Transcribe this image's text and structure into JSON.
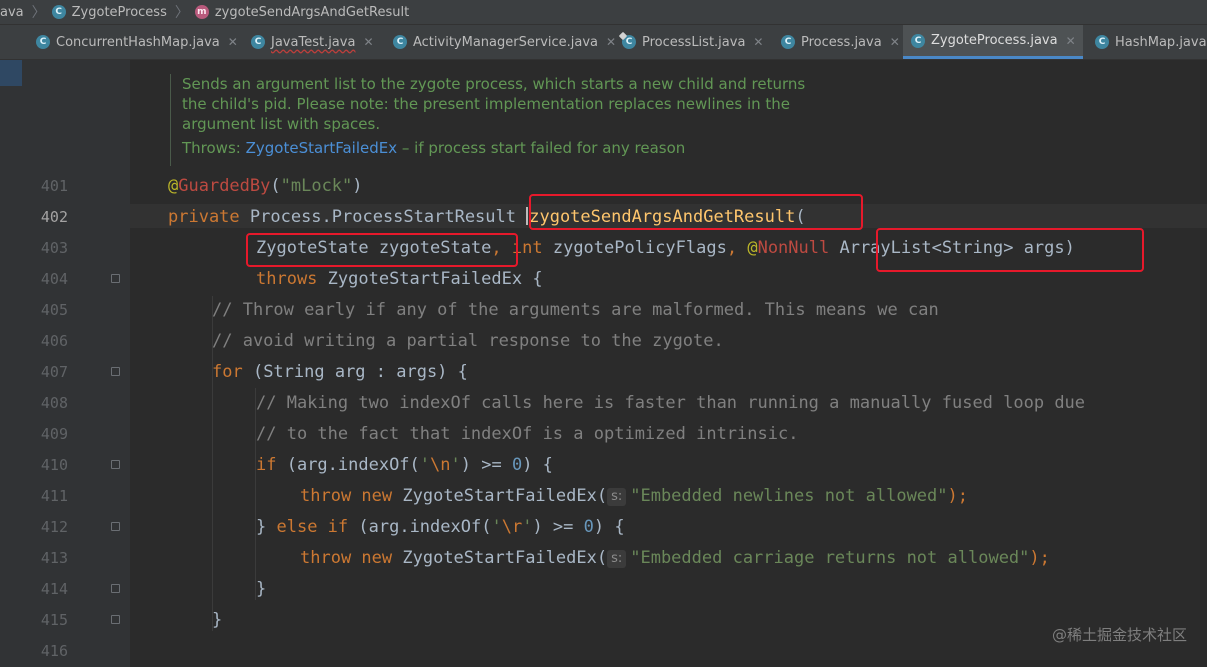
{
  "breadcrumb": {
    "items": [
      {
        "label": "ava",
        "icon": null
      },
      {
        "label": "ZygoteProcess",
        "icon": "class-icon"
      },
      {
        "label": "zygoteSendArgsAndGetResult",
        "icon": "method-icon"
      }
    ]
  },
  "tabs": [
    {
      "label": "ConcurrentHashMap.java",
      "icon": "class-icon",
      "active": false
    },
    {
      "label": "JavaTest.java",
      "icon": "class-icon",
      "active": false,
      "error": true
    },
    {
      "label": "ActivityManagerService.java",
      "icon": "class-icon",
      "active": false
    },
    {
      "label": "ProcessList.java",
      "icon": "class-icon",
      "active": false
    },
    {
      "label": "Process.java",
      "icon": "class-icon",
      "active": false
    },
    {
      "label": "ZygoteProcess.java",
      "icon": "class-icon",
      "active": true
    },
    {
      "label": "HashMap.java",
      "icon": "class-icon",
      "active": false
    }
  ],
  "doc_comment": {
    "lines": [
      "Sends an argument list to the zygote process, which starts a new child and returns",
      "the child's pid. Please note: the present implementation replaces newlines in the",
      "argument list with spaces."
    ],
    "throws_label": "Throws:",
    "throws_link": "ZygoteStartFailedEx",
    "throws_text": " – if process start failed for any reason"
  },
  "line_numbers": [
    "401",
    "402",
    "403",
    "404",
    "405",
    "406",
    "407",
    "408",
    "409",
    "410",
    "411",
    "412",
    "413",
    "414",
    "415",
    "416"
  ],
  "current_line": "402",
  "code": {
    "l401": {
      "at": "@",
      "annotation": "GuardedBy",
      "open": "(",
      "str": "\"mLock\"",
      "close": ")"
    },
    "l402": {
      "kw": "private",
      "type": " Process.ProcessStartResult ",
      "method": "zygoteSendArgsAndGetResult",
      "paren": "("
    },
    "l403": {
      "p1": "ZygoteState zygoteState",
      "comma1": ",",
      "kw_int": " int",
      "p2": " zygotePolicyFlags",
      "comma2": ",",
      "at": " @",
      "annotation": "NonNull",
      "p3": " ArrayList<String> args",
      "close": ")"
    },
    "l404": {
      "kw": "throws",
      "rest": " ZygoteStartFailedEx {"
    },
    "l405": "// Throw early if any of the arguments are malformed. This means we can",
    "l406": "// avoid writing a partial response to the zygote.",
    "l407": {
      "kw": "for",
      "rest": " (String arg : args) {"
    },
    "l408": "// Making two indexOf calls here is faster than running a manually fused loop due",
    "l409": "// to the fact that indexOf is a optimized intrinsic.",
    "l410": {
      "kw": "if",
      "a": " (arg.indexOf(",
      "q1": "'",
      "esc": "\\n",
      "q2": "'",
      "b": ") >= ",
      "num": "0",
      "c": ") {"
    },
    "l411": {
      "kw1": "throw",
      "kw2": " new",
      "type": " ZygoteStartFailedEx(",
      "hint": "s:",
      "str": "\"Embedded newlines not allowed\"",
      "end": ");"
    },
    "l412": {
      "brace": "} ",
      "kw1": "else",
      "kw2": " if",
      "a": " (arg.indexOf(",
      "q1": "'",
      "esc": "\\r",
      "q2": "'",
      "b": ") >= ",
      "num": "0",
      "c": ") {"
    },
    "l413": {
      "kw1": "throw",
      "kw2": " new",
      "type": " ZygoteStartFailedEx(",
      "hint": "s:",
      "str": "\"Embedded carriage returns not allowed\"",
      "end": ");"
    },
    "l414": "}",
    "l415": "}"
  },
  "watermark": "@稀土掘金技术社区",
  "colors": {
    "editor_bg": "#2b2b2b",
    "keyword": "#cc7832",
    "string": "#6a8759",
    "comment": "#808080",
    "method": "#ffc66d",
    "annotation": "#bbb529",
    "doc_comment": "#629755",
    "highlight_box": "#e6192b",
    "active_tab_underline": "#4a88c7"
  }
}
